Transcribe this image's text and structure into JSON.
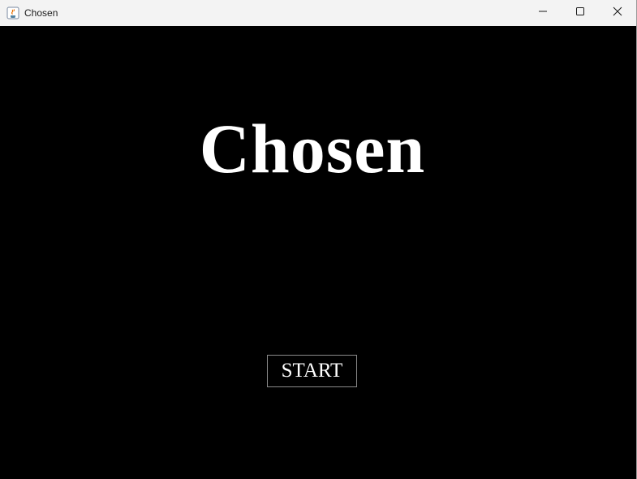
{
  "window": {
    "title": "Chosen",
    "app_icon": "java-cup-icon",
    "controls": {
      "minimize_icon": "minimize-icon",
      "maximize_icon": "maximize-icon",
      "close_icon": "close-icon"
    }
  },
  "screen": {
    "title": "Chosen",
    "start_label": "START",
    "background_color": "#000000",
    "text_color": "#ffffff"
  }
}
